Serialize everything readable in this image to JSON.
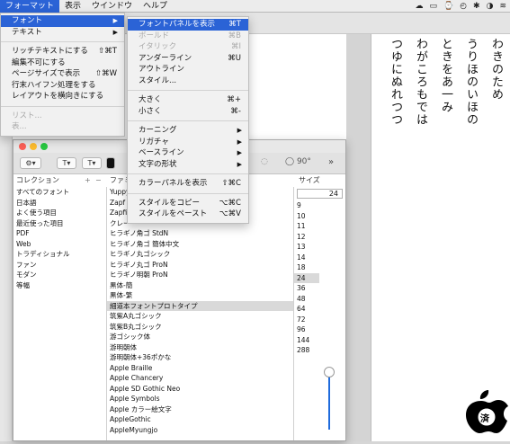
{
  "menubar": {
    "items": [
      "フォーマット",
      "表示",
      "ウインドウ",
      "ヘルプ"
    ],
    "status_glyphs": [
      "☁",
      "▭",
      "⌚",
      "◴",
      "✱",
      "◑",
      "≋"
    ]
  },
  "document": {
    "columns": [
      "わきのため",
      "うりほのいほの",
      "ときをあ一み",
      "わがころもでは",
      "つゆにぬれつつ"
    ]
  },
  "format_menu": {
    "items": [
      {
        "label": "フォント",
        "shortcut": "",
        "submenu": true,
        "state": "active"
      },
      {
        "label": "テキスト",
        "shortcut": "",
        "submenu": true,
        "state": "normal"
      },
      {
        "sep": true
      },
      {
        "label": "リッチテキストにする",
        "shortcut": "⇧⌘T",
        "submenu": false,
        "state": "normal"
      },
      {
        "label": "編集不可にする",
        "shortcut": "",
        "submenu": false,
        "state": "normal"
      },
      {
        "label": "ページサイズで表示",
        "shortcut": "⇧⌘W",
        "submenu": false,
        "state": "normal"
      },
      {
        "label": "行末ハイフン処理をする",
        "shortcut": "",
        "submenu": false,
        "state": "normal"
      },
      {
        "label": "レイアウトを横向きにする",
        "shortcut": "",
        "submenu": false,
        "state": "normal"
      },
      {
        "sep": true
      },
      {
        "label": "リスト...",
        "shortcut": "",
        "submenu": false,
        "state": "disabled"
      },
      {
        "label": "表...",
        "shortcut": "",
        "submenu": false,
        "state": "disabled"
      }
    ]
  },
  "font_submenu": {
    "items": [
      {
        "label": "フォントパネルを表示",
        "shortcut": "⌘T",
        "submenu": false,
        "state": "active"
      },
      {
        "label": "ボールド",
        "shortcut": "⌘B",
        "submenu": false,
        "state": "disabled"
      },
      {
        "label": "イタリック",
        "shortcut": "⌘I",
        "submenu": false,
        "state": "disabled"
      },
      {
        "label": "アンダーライン",
        "shortcut": "⌘U",
        "submenu": false,
        "state": "normal"
      },
      {
        "label": "アウトライン",
        "shortcut": "",
        "submenu": false,
        "state": "normal"
      },
      {
        "label": "スタイル...",
        "shortcut": "",
        "submenu": false,
        "state": "normal"
      },
      {
        "sep": true
      },
      {
        "label": "大きく",
        "shortcut": "⌘+",
        "submenu": false,
        "state": "normal"
      },
      {
        "label": "小さく",
        "shortcut": "⌘-",
        "submenu": false,
        "state": "normal"
      },
      {
        "sep": true
      },
      {
        "label": "カーニング",
        "shortcut": "",
        "submenu": true,
        "state": "normal"
      },
      {
        "label": "リガチャ",
        "shortcut": "",
        "submenu": true,
        "state": "normal"
      },
      {
        "label": "ベースライン",
        "shortcut": "",
        "submenu": true,
        "state": "normal"
      },
      {
        "label": "文字の形状",
        "shortcut": "",
        "submenu": true,
        "state": "normal"
      },
      {
        "sep": true
      },
      {
        "label": "カラーパネルを表示",
        "shortcut": "⇧⌘C",
        "submenu": false,
        "state": "normal"
      },
      {
        "sep": true
      },
      {
        "label": "スタイルをコピー",
        "shortcut": "⌥⌘C",
        "submenu": false,
        "state": "normal"
      },
      {
        "label": "スタイルをペースト",
        "shortcut": "⌥⌘V",
        "submenu": false,
        "state": "normal"
      }
    ]
  },
  "font_panel": {
    "toolbar": {
      "angle": "90°",
      "more": "»"
    },
    "headers": {
      "collection": "コレクション",
      "family": "ファミ",
      "size": "サイズ",
      "add": "+",
      "remove": "−"
    },
    "collections": [
      "すべてのフォント",
      "日本語",
      "よく使う項目",
      "最近使った項目",
      "PDF",
      "Web",
      "トラディショナル",
      "ファン",
      "モダン",
      "等幅"
    ],
    "families": [
      "Yuppy",
      "Zapf D",
      "Zapfin",
      "クレー",
      "ヒラギノ角ゴ StdN",
      "ヒラギノ角ゴ 簡体中文",
      "ヒラギノ丸ゴシック",
      "ヒラギノ丸ゴ ProN",
      "ヒラギノ明朝 ProN",
      "黒体-簡",
      "黒体-繁",
      "細道本フォントプロトタイプ",
      "筑紫A丸ゴシック",
      "筑紫B丸ゴシック",
      "游ゴシック体",
      "游明朝体",
      "游明朝体+36ポかな",
      "Apple Braille",
      "Apple Chancery",
      "Apple SD Gothic Neo",
      "Apple Symbols",
      "Apple カラー絵文字",
      "AppleGothic",
      "AppleMyungjo"
    ],
    "selected_family": "細道本フォントプロトタイプ",
    "size_value": "24",
    "sizes": [
      "9",
      "10",
      "11",
      "12",
      "13",
      "14",
      "18",
      "24",
      "36",
      "48",
      "64",
      "72",
      "96",
      "144",
      "288"
    ],
    "selected_size": "24"
  },
  "logo": {
    "text": "済"
  }
}
